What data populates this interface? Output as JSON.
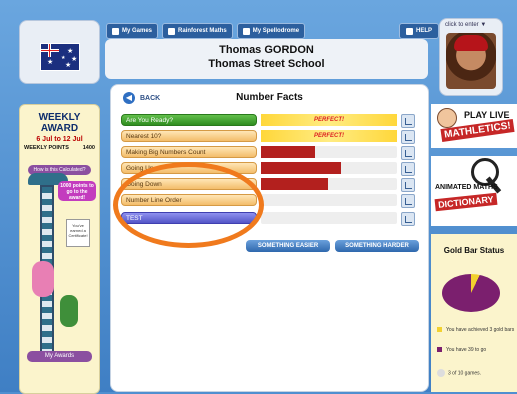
{
  "header": {
    "nav": [
      "My Games",
      "Rainforest Maths",
      "My Spellodrome"
    ],
    "help": "HELP",
    "student_name": "Thomas GORDON",
    "school": "Thomas Street School",
    "avatar_hint": "click to enter ▼"
  },
  "left_panel": {
    "weekly_award": "WEEKLY AWARD",
    "date_range": "6 Jul to 12 Jul",
    "weekly_points_label": "WEEKLY POINTS",
    "weekly_points_value": "1400",
    "calculator_button": "How is this Calculated?",
    "points_tag": "1000 points to go to the award!",
    "certificate": "You've earned a Certificate!",
    "awards_button": "My Awards"
  },
  "main": {
    "back_label": "BACK",
    "title": "Number Facts",
    "rows": [
      {
        "label": "Are You Ready?",
        "state": "perfect",
        "progress": 1.0,
        "perfect_text": "PERFECT!",
        "style": "green"
      },
      {
        "label": "Nearest 10?",
        "state": "perfect",
        "progress": 1.0,
        "perfect_text": "PERFECT!",
        "style": "orange"
      },
      {
        "label": "Making Big Numbers Count",
        "state": "bar",
        "progress": 0.4,
        "style": "orange"
      },
      {
        "label": "Going Up",
        "state": "bar",
        "progress": 0.59,
        "style": "orange"
      },
      {
        "label": "Going Down",
        "state": "bar",
        "progress": 0.49,
        "style": "orange"
      },
      {
        "label": "Number Line Order",
        "state": "bar",
        "progress": 0.0,
        "style": "orange"
      },
      {
        "label": "TEST",
        "state": "bar",
        "progress": 0.0,
        "style": "blue"
      }
    ],
    "buttons": {
      "easier": "SOMETHING EASIER",
      "harder": "SOMETHING HARDER"
    }
  },
  "right_panel": {
    "mathletics_top": "PLAY LIVE",
    "mathletics_bottom": "MATHLETICS!",
    "dict_top": "ANIMATED MATHS",
    "dict_bottom": "DICTIONARY",
    "gold_title": "Gold Bar Status",
    "achieved": "You have achieved 3 gold bars",
    "to_go": "You have 39 to go",
    "games": "3 of 10 games."
  },
  "colors": {
    "gold": "#f2d12f",
    "purple": "#7b1f6e",
    "bar_red": "#b3201e",
    "highlight_ring": "#f07a1d"
  }
}
